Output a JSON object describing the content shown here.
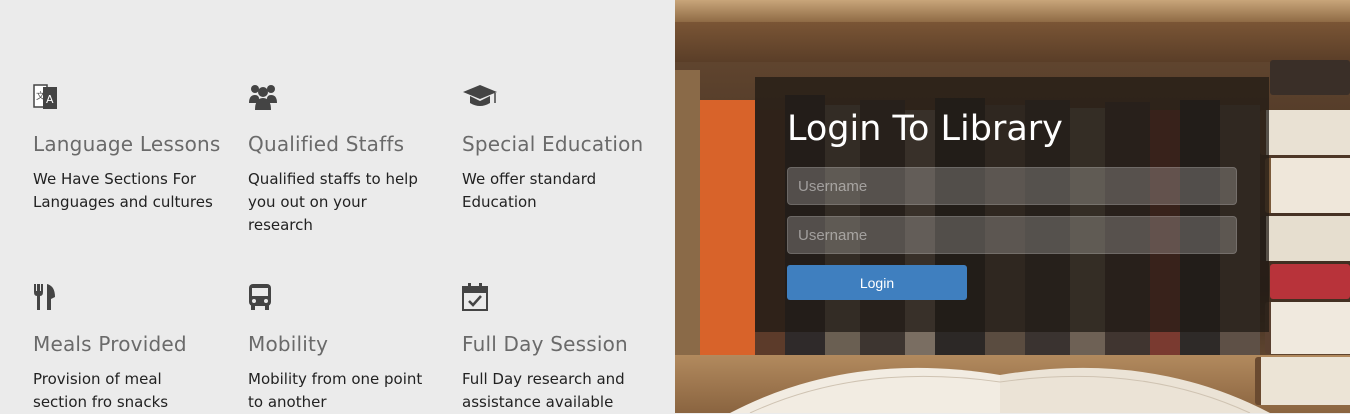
{
  "features": [
    {
      "icon": "language-icon",
      "title": "Language Lessons",
      "description": "We Have Sections For Languages and cultures"
    },
    {
      "icon": "users-icon",
      "title": "Qualified Staffs",
      "description": "Qualified staffs to help you out on your research"
    },
    {
      "icon": "graduation-cap-icon",
      "title": "Special Education",
      "description": "We offer standard Education"
    },
    {
      "icon": "fork-knife-icon",
      "title": "Meals Provided",
      "description": "Provision of meal section fro snacks"
    },
    {
      "icon": "bus-icon",
      "title": "Mobility",
      "description": "Mobility from one point to another"
    },
    {
      "icon": "calendar-check-icon",
      "title": "Full Day Session",
      "description": "Full Day research and assistance available"
    }
  ],
  "login": {
    "title": "Login To Library",
    "username_placeholder": "Username",
    "password_placeholder": "Username",
    "button_label": "Login"
  },
  "colors": {
    "background": "#ebebeb",
    "feature_title": "#6a6a6a",
    "button": "#3f7fbf"
  }
}
